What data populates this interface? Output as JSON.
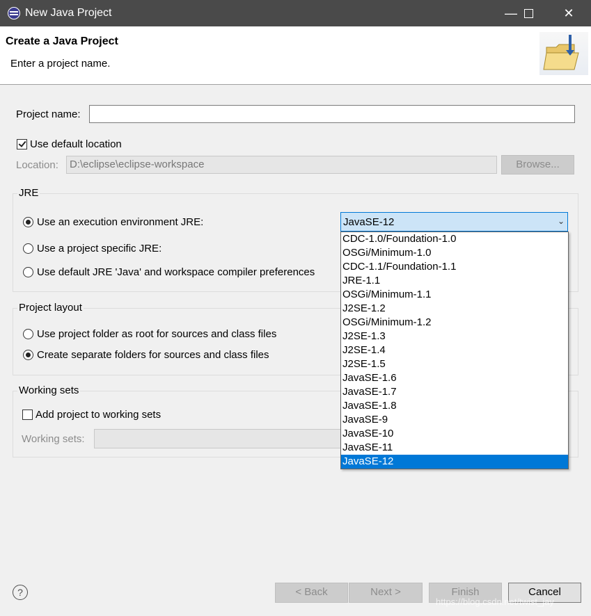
{
  "window": {
    "title": "New Java Project"
  },
  "banner": {
    "title": "Create a Java Project",
    "message": "Enter a project name."
  },
  "project_name": {
    "label": "Project name:",
    "value": ""
  },
  "location": {
    "use_default_label": "Use default location",
    "use_default_checked": true,
    "label": "Location:",
    "value": "D:\\eclipse\\eclipse-workspace",
    "browse_label": "Browse..."
  },
  "jre": {
    "group_title": "JRE",
    "options": [
      "Use an execution environment JRE:",
      "Use a project specific JRE:",
      "Use default JRE 'Java' and workspace compiler preferences"
    ],
    "selected_option": 0,
    "combo_value": "JavaSE-12",
    "dropdown_items": [
      "CDC-1.0/Foundation-1.0",
      "OSGi/Minimum-1.0",
      "CDC-1.1/Foundation-1.1",
      "JRE-1.1",
      "OSGi/Minimum-1.1",
      "J2SE-1.2",
      "OSGi/Minimum-1.2",
      "J2SE-1.3",
      "J2SE-1.4",
      "J2SE-1.5",
      "JavaSE-1.6",
      "JavaSE-1.7",
      "JavaSE-1.8",
      "JavaSE-9",
      "JavaSE-10",
      "JavaSE-11",
      "JavaSE-12"
    ],
    "dropdown_selected": 16
  },
  "layout": {
    "group_title": "Project layout",
    "options": [
      "Use project folder as root for sources and class files",
      "Create separate folders for sources and class files"
    ],
    "selected_option": 1
  },
  "working_sets": {
    "group_title": "Working sets",
    "add_label": "Add project to working sets",
    "add_checked": false,
    "label": "Working sets:"
  },
  "buttons": {
    "back": "< Back",
    "next": "Next >",
    "finish": "Finish",
    "cancel": "Cancel",
    "help": "?"
  },
  "watermark": "https://blog.csdn.net/twist_jay",
  "colors": {
    "accent": "#0078d7",
    "titlebar": "#4a4a4a"
  }
}
